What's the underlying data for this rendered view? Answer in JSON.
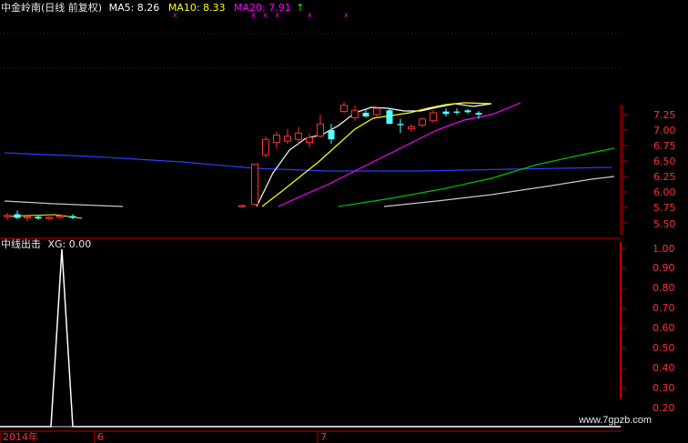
{
  "main_panel": {
    "stock_name": "中金岭南",
    "period_label": "(日线 前复权)",
    "ma5": {
      "label": "MA5: 8.26",
      "color": "#ffffff"
    },
    "ma10": {
      "label": "MA10: 8.33",
      "color": "#ffff00"
    },
    "ma20": {
      "label": "MA20: 7.91",
      "color": "#ff00ff"
    },
    "price_axis": {
      "ticks": [
        "7.25",
        "7.00",
        "6.75",
        "6.50",
        "6.25",
        "6.00",
        "5.75",
        "5.50"
      ]
    }
  },
  "indicator_panel": {
    "title": "中线出击",
    "value_label": "XG: 0.00",
    "axis": {
      "ticks": [
        "1.00",
        "0.90",
        "0.80",
        "0.70",
        "0.60",
        "0.50",
        "0.40",
        "0.30",
        "0.20"
      ]
    }
  },
  "time_axis": {
    "labels": [
      "2014年",
      "6",
      "7"
    ]
  },
  "watermark": "www.7gpzb.com",
  "colors": {
    "up": "#ff3030",
    "down": "#54ffff",
    "axis": "#c00000",
    "blue_ma": "#2a3cff",
    "green_ma": "#00c000",
    "gray_ma": "#c0c0c0"
  },
  "chart_data": {
    "type": "candlestick",
    "title": "中金岭南(日线 前复权)",
    "ylim": [
      5.4,
      7.4
    ],
    "candles": [
      {
        "o": 5.6,
        "h": 5.66,
        "l": 5.55,
        "c": 5.62
      },
      {
        "o": 5.64,
        "h": 5.7,
        "l": 5.56,
        "c": 5.58
      },
      {
        "o": 5.58,
        "h": 5.62,
        "l": 5.53,
        "c": 5.6
      },
      {
        "o": 5.6,
        "h": 5.63,
        "l": 5.55,
        "c": 5.57
      },
      {
        "o": 5.57,
        "h": 5.61,
        "l": 5.54,
        "c": 5.59
      },
      {
        "o": 5.59,
        "h": 5.64,
        "l": 5.56,
        "c": 5.61
      },
      {
        "o": 5.61,
        "h": 5.64,
        "l": 5.56,
        "c": 5.58
      },
      {
        "o": 5.76,
        "h": 5.8,
        "l": 5.74,
        "c": 5.78
      },
      {
        "o": 5.8,
        "h": 6.45,
        "l": 5.78,
        "c": 6.45
      },
      {
        "o": 6.6,
        "h": 6.9,
        "l": 6.55,
        "c": 6.85
      },
      {
        "o": 6.8,
        "h": 6.97,
        "l": 6.7,
        "c": 6.92
      },
      {
        "o": 6.82,
        "h": 7.02,
        "l": 6.78,
        "c": 6.9
      },
      {
        "o": 6.85,
        "h": 7.05,
        "l": 6.78,
        "c": 6.95
      },
      {
        "o": 6.8,
        "h": 6.95,
        "l": 6.72,
        "c": 6.88
      },
      {
        "o": 6.9,
        "h": 7.25,
        "l": 6.88,
        "c": 7.1
      },
      {
        "o": 7.0,
        "h": 7.1,
        "l": 6.78,
        "c": 6.85
      },
      {
        "o": 7.3,
        "h": 7.45,
        "l": 7.28,
        "c": 7.4
      },
      {
        "o": 7.2,
        "h": 7.4,
        "l": 7.15,
        "c": 7.32
      },
      {
        "o": 7.28,
        "h": 7.35,
        "l": 7.2,
        "c": 7.22
      },
      {
        "o": 7.25,
        "h": 7.38,
        "l": 7.2,
        "c": 7.35
      },
      {
        "o": 7.32,
        "h": 7.35,
        "l": 7.15,
        "c": 7.1
      },
      {
        "o": 7.1,
        "h": 7.18,
        "l": 6.95,
        "c": 7.08
      },
      {
        "o": 7.02,
        "h": 7.1,
        "l": 6.98,
        "c": 7.05
      },
      {
        "o": 7.08,
        "h": 7.2,
        "l": 7.05,
        "c": 7.18
      },
      {
        "o": 7.15,
        "h": 7.32,
        "l": 7.12,
        "c": 7.28
      },
      {
        "o": 7.3,
        "h": 7.35,
        "l": 7.22,
        "c": 7.26
      },
      {
        "o": 7.3,
        "h": 7.35,
        "l": 7.25,
        "c": 7.28
      },
      {
        "o": 7.32,
        "h": 7.34,
        "l": 7.26,
        "c": 7.29
      },
      {
        "o": 7.28,
        "h": 7.31,
        "l": 7.18,
        "c": 7.25
      }
    ]
  }
}
